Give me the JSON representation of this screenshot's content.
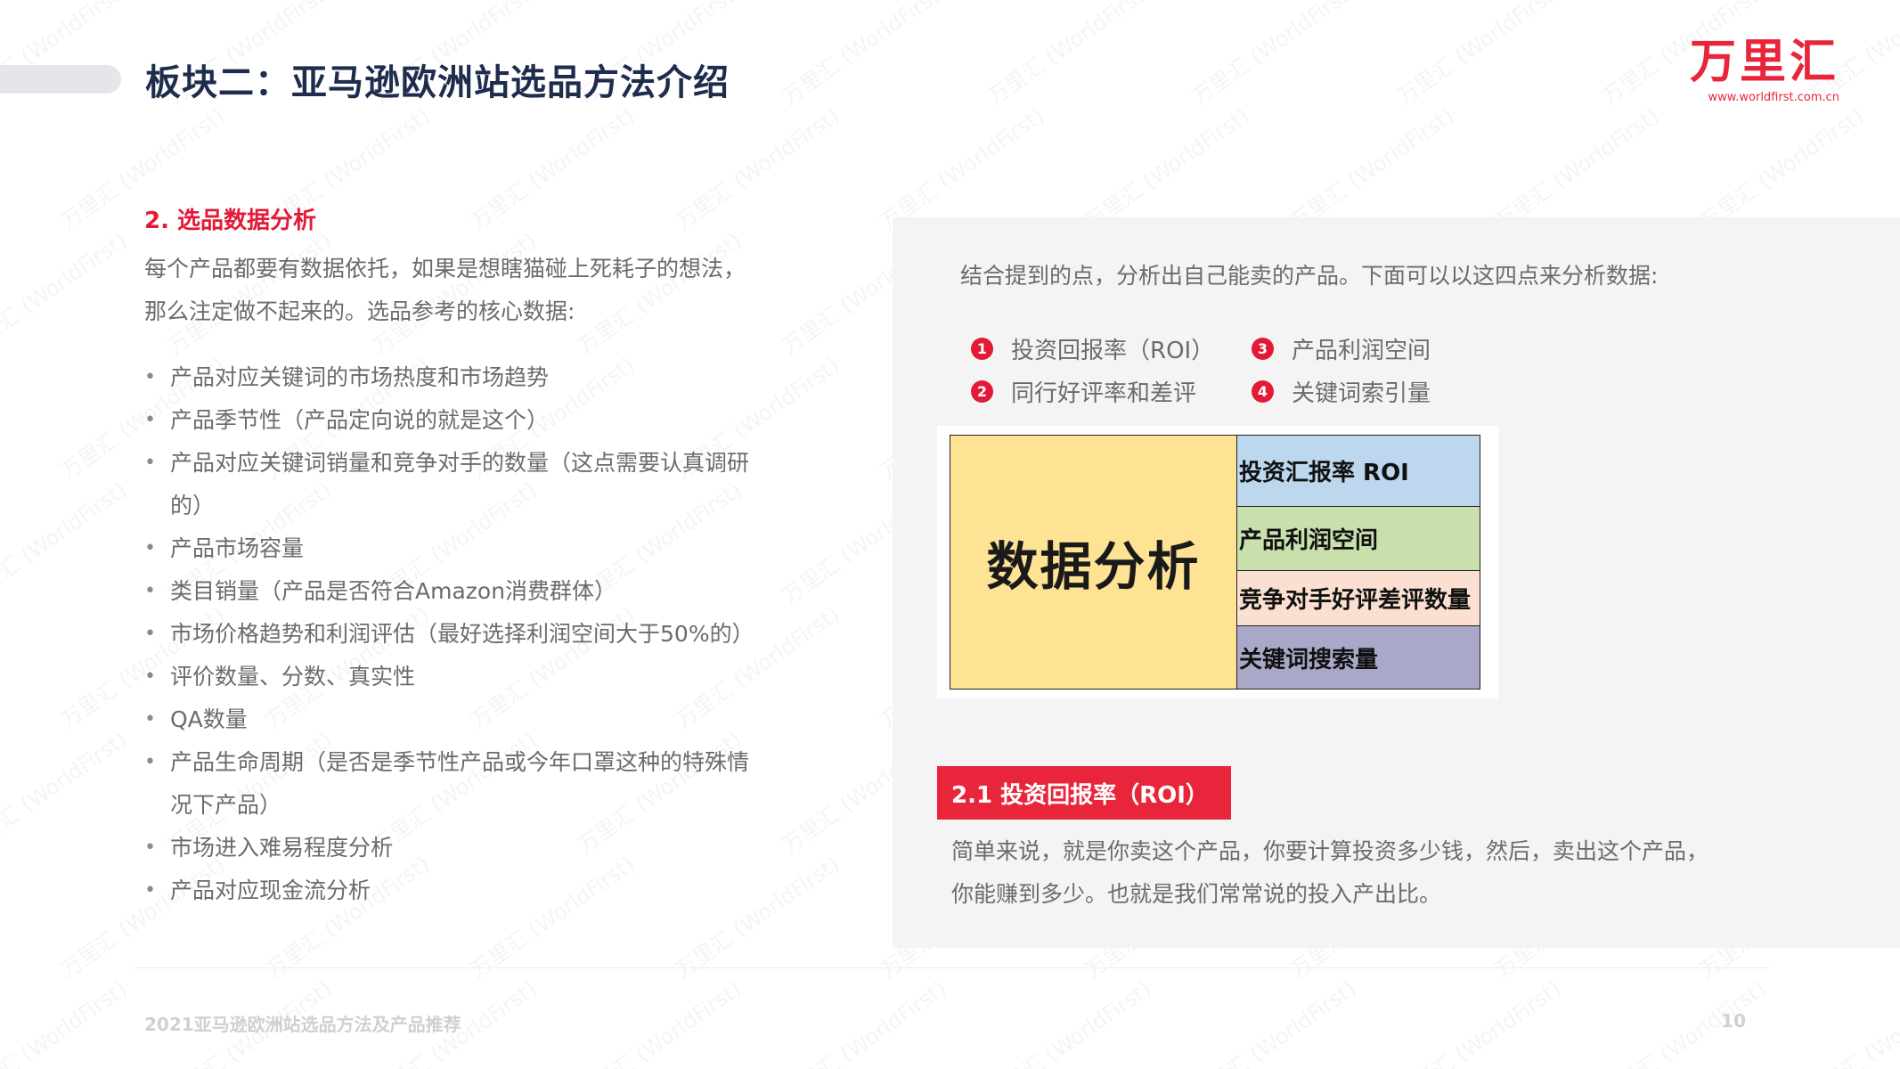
{
  "header": {
    "title": "板块二：亚马逊欧洲站选品方法介绍",
    "logo_text": "万里汇",
    "logo_url": "www.worldfirst.com.cn"
  },
  "left": {
    "section_title": "2. 选品数据分析",
    "intro": "每个产品都要有数据依托，如果是想瞎猫碰上死耗子的想法，那么注定做不起来的。选品参考的核心数据:",
    "bullets": [
      "产品对应关键词的市场热度和市场趋势",
      "产品季节性（产品定向说的就是这个）",
      "产品对应关键词销量和竞争对手的数量（这点需要认真调研的）",
      "产品市场容量",
      "类目销量（产品是否符合Amazon消费群体）",
      "市场价格趋势和利润评估（最好选择利润空间大于50%的）",
      "评价数量、分数、真实性",
      "QA数量",
      "产品生命周期（是否是季节性产品或今年口罩这种的特殊情况下产品）",
      "市场进入难易程度分析",
      "产品对应现金流分析"
    ]
  },
  "right": {
    "intro": "结合提到的点，分析出自己能卖的产品。下面可以以这四点来分析数据:",
    "points": [
      {
        "num": "1",
        "label": "投资回报率（ROI）"
      },
      {
        "num": "3",
        "label": "产品利润空间"
      },
      {
        "num": "2",
        "label": "同行好评率和差评"
      },
      {
        "num": "4",
        "label": "关键词索引量"
      }
    ],
    "diagram": {
      "main": "数据分析",
      "rows": [
        "投资汇报率 ROI",
        "产品利润空间",
        "竞争对手好评差评数量",
        "关键词搜索量"
      ],
      "colors": [
        "#bcd7ee",
        "#c9e0ad",
        "#fbe0d2",
        "#a9a8c8"
      ],
      "main_color": "#fde393"
    },
    "sub_title": "2.1 投资回报率（ROI）",
    "sub_text": "简单来说，就是你卖这个产品，你要计算投资多少钱，然后，卖出这个产品，你能赚到多少。也就是我们常常说的投入产出比。"
  },
  "footer": {
    "left": "2021亚马逊欧洲站选品方法及产品推荐",
    "page": "10"
  },
  "colors": {
    "accent": "#e31937",
    "title": "#1f2d4d",
    "panel": "#f4f4f4"
  }
}
